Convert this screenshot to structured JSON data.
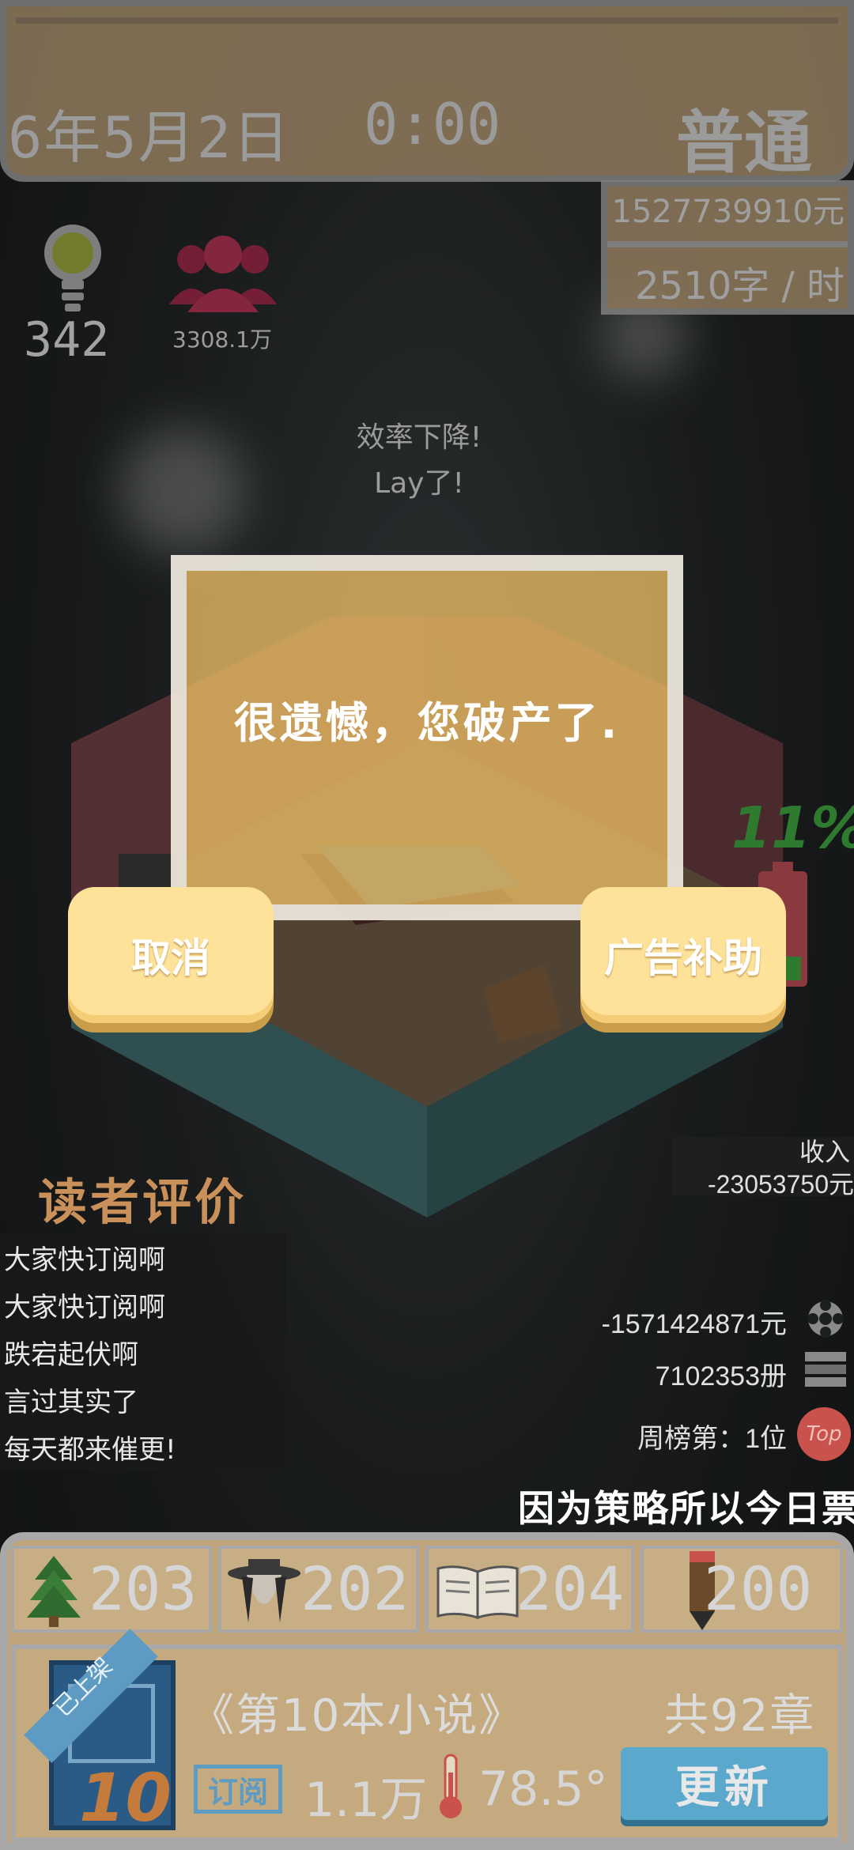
{
  "top_bar": {
    "date": "6年5月2日",
    "time": "0:00",
    "mode": "普通",
    "money": "1527739910元",
    "speed": "2510字 / 时"
  },
  "stats": {
    "inspiration": "342",
    "fans": "3308.1万"
  },
  "notices": [
    "效率下降!",
    "Lay了!"
  ],
  "dialog": {
    "message": "很遗憾，您破产了.",
    "cancel_label": "取消",
    "ad_label": "广告补助"
  },
  "battery_pct": "11%",
  "reviews": {
    "title": "读者评价",
    "items": [
      "大家快订阅啊",
      "大家快订阅啊",
      "跌宕起伏啊",
      "言过其实了",
      "每天都来催更!"
    ]
  },
  "income": {
    "label": "收入",
    "value": "-23053750元"
  },
  "metrics": {
    "cost": "-1571424871元",
    "books": "7102353册",
    "rank": "周榜第：1位",
    "rank_badge": "Top"
  },
  "ticker": "因为策略所以今日票",
  "attributes": [
    {
      "icon": "tree-icon",
      "value": "203"
    },
    {
      "icon": "character-icon",
      "value": "202"
    },
    {
      "icon": "open-book-icon",
      "value": "204"
    },
    {
      "icon": "pencil-icon",
      "value": "200"
    }
  ],
  "book": {
    "status": "已上架",
    "number": "10",
    "title": "《第10本小说》",
    "chapters": "共92章",
    "subscribe_label": "订阅",
    "subscribers": "1.1万",
    "heat": "78.5°",
    "update_label": "更新"
  },
  "colors": {
    "panel": "#bfa47c",
    "dialog": "#ebbe64",
    "button": "#ffe29a",
    "accent_blue": "#5aa8cc",
    "review_title": "#c9905a"
  }
}
